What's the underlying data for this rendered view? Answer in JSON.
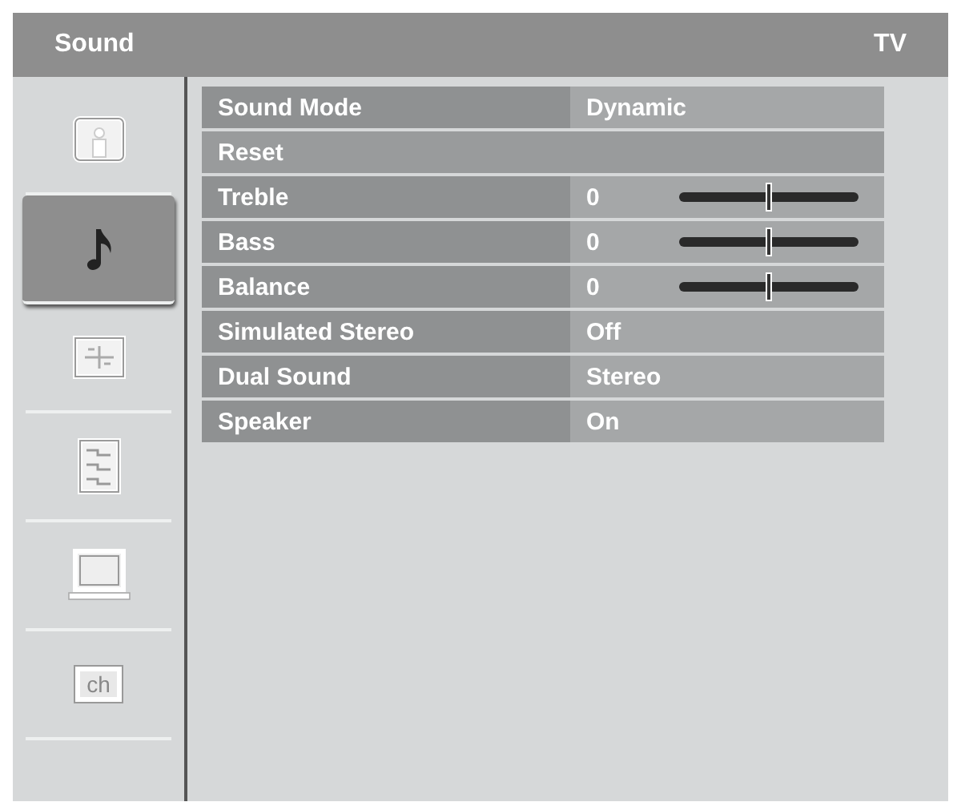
{
  "header": {
    "title": "Sound",
    "source": "TV"
  },
  "sidebar": {
    "items": [
      {
        "kind": "picture",
        "selected": false
      },
      {
        "kind": "sound",
        "selected": true
      },
      {
        "kind": "setup",
        "selected": false
      },
      {
        "kind": "features",
        "selected": false
      },
      {
        "kind": "screen",
        "selected": false
      },
      {
        "kind": "channel",
        "label": "ch",
        "selected": false
      }
    ]
  },
  "menu": {
    "rows": [
      {
        "kind": "value",
        "label": "Sound Mode",
        "value": "Dynamic"
      },
      {
        "kind": "action",
        "label": "Reset"
      },
      {
        "kind": "slider",
        "label": "Treble",
        "value": "0",
        "level": 0.5
      },
      {
        "kind": "slider",
        "label": "Bass",
        "value": "0",
        "level": 0.5
      },
      {
        "kind": "slider",
        "label": "Balance",
        "value": "0",
        "level": 0.5
      },
      {
        "kind": "value",
        "label": "Simulated Stereo",
        "value": "Off"
      },
      {
        "kind": "value",
        "label": "Dual Sound",
        "value": "Stereo"
      },
      {
        "kind": "value",
        "label": "Speaker",
        "value": "On"
      }
    ]
  }
}
